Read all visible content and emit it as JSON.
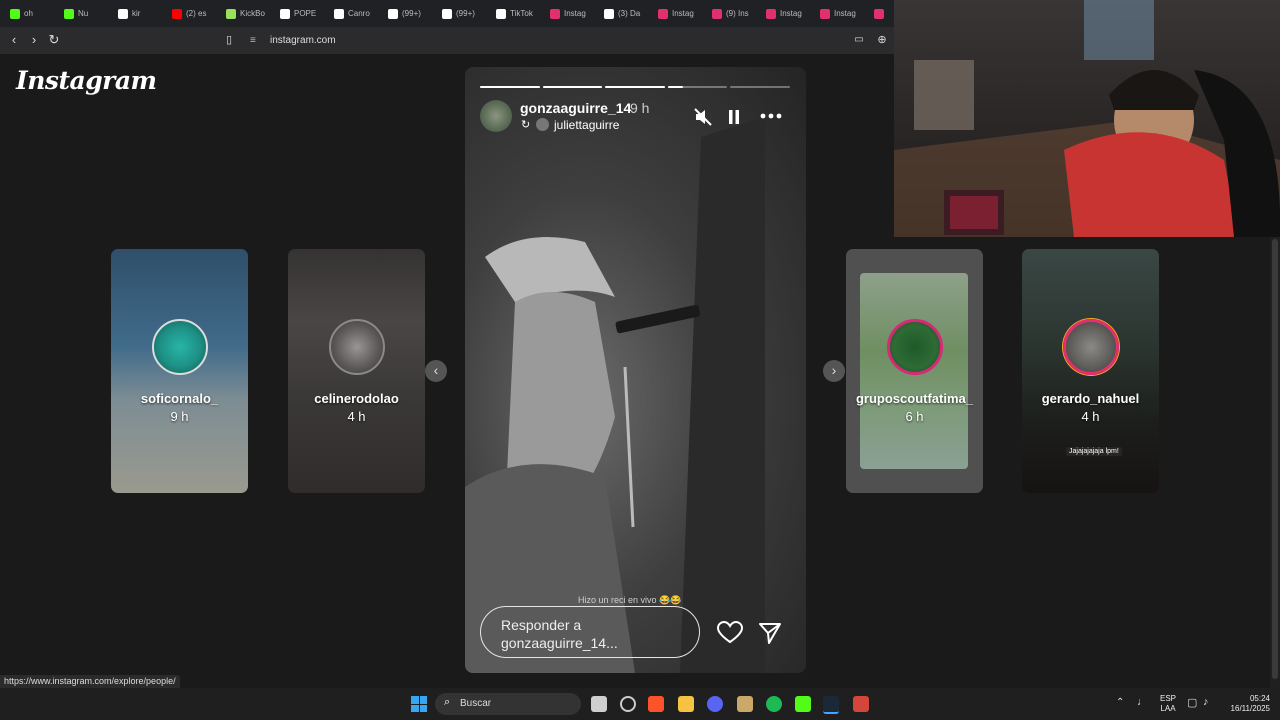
{
  "browser": {
    "tabs": [
      {
        "label": "oh",
        "icon": "kick-icon",
        "color": "#53fc18"
      },
      {
        "label": "Nu",
        "icon": "kick-icon",
        "color": "#53fc18"
      },
      {
        "label": "kir",
        "icon": "tiktok-icon",
        "color": "#ffffff"
      },
      {
        "label": "(2) es",
        "icon": "youtube-icon",
        "color": "#ff0000"
      },
      {
        "label": "KickBo",
        "icon": "kickbot-icon",
        "color": "#9be05a"
      },
      {
        "label": "POPE",
        "icon": "google-icon",
        "color": "#ffffff"
      },
      {
        "label": "Canro",
        "icon": "tiktok-icon",
        "color": "#ffffff"
      },
      {
        "label": "(99+)",
        "icon": "tiktok-icon",
        "color": "#ffffff"
      },
      {
        "label": "(99+)",
        "icon": "tiktok-icon",
        "color": "#ffffff"
      },
      {
        "label": "TikTok",
        "icon": "tiktok-icon",
        "color": "#ffffff"
      },
      {
        "label": "Instag",
        "icon": "instagram-icon",
        "color": "#e1306c"
      },
      {
        "label": "(3) Da",
        "icon": "x-icon",
        "color": "#ffffff"
      },
      {
        "label": "Instag",
        "icon": "instagram-icon",
        "color": "#e1306c"
      },
      {
        "label": "(9) Ins",
        "icon": "instagram-icon",
        "color": "#e1306c"
      },
      {
        "label": "Instag",
        "icon": "instagram-icon",
        "color": "#e1306c"
      },
      {
        "label": "Instag",
        "icon": "instagram-icon",
        "color": "#e1306c"
      },
      {
        "label": "",
        "icon": "instagram-icon",
        "color": "#e1306c"
      }
    ],
    "url": "instagram.com",
    "status_url": "https://www.instagram.com/explore/people/"
  },
  "instagram": {
    "logo": "Instagram",
    "stories_left": [
      {
        "name": "soficornalo_",
        "time": "9 h"
      },
      {
        "name": "celinerodolao",
        "time": "4 h"
      }
    ],
    "stories_right": [
      {
        "name": "gruposcoutfatima_",
        "time": "6 h"
      },
      {
        "name": "gerardo_nahuel",
        "time": "4 h",
        "caption": "Jajajajajaja lpm!"
      }
    ],
    "active_story": {
      "username": "gonzaaguirre_14",
      "time": "9 h",
      "reshared_from": "juliettaguirre",
      "caption": "Hizo un reci en vivo 😂😂",
      "reply_placeholder": "Responder a gonzaaguirre_14...",
      "progress_segments": [
        1,
        1,
        1,
        0.25,
        0
      ]
    }
  },
  "taskbar": {
    "search_placeholder": "Buscar",
    "lang": "ESP",
    "layout": "LAA",
    "time": "05:24",
    "date": "16/11/2025"
  }
}
